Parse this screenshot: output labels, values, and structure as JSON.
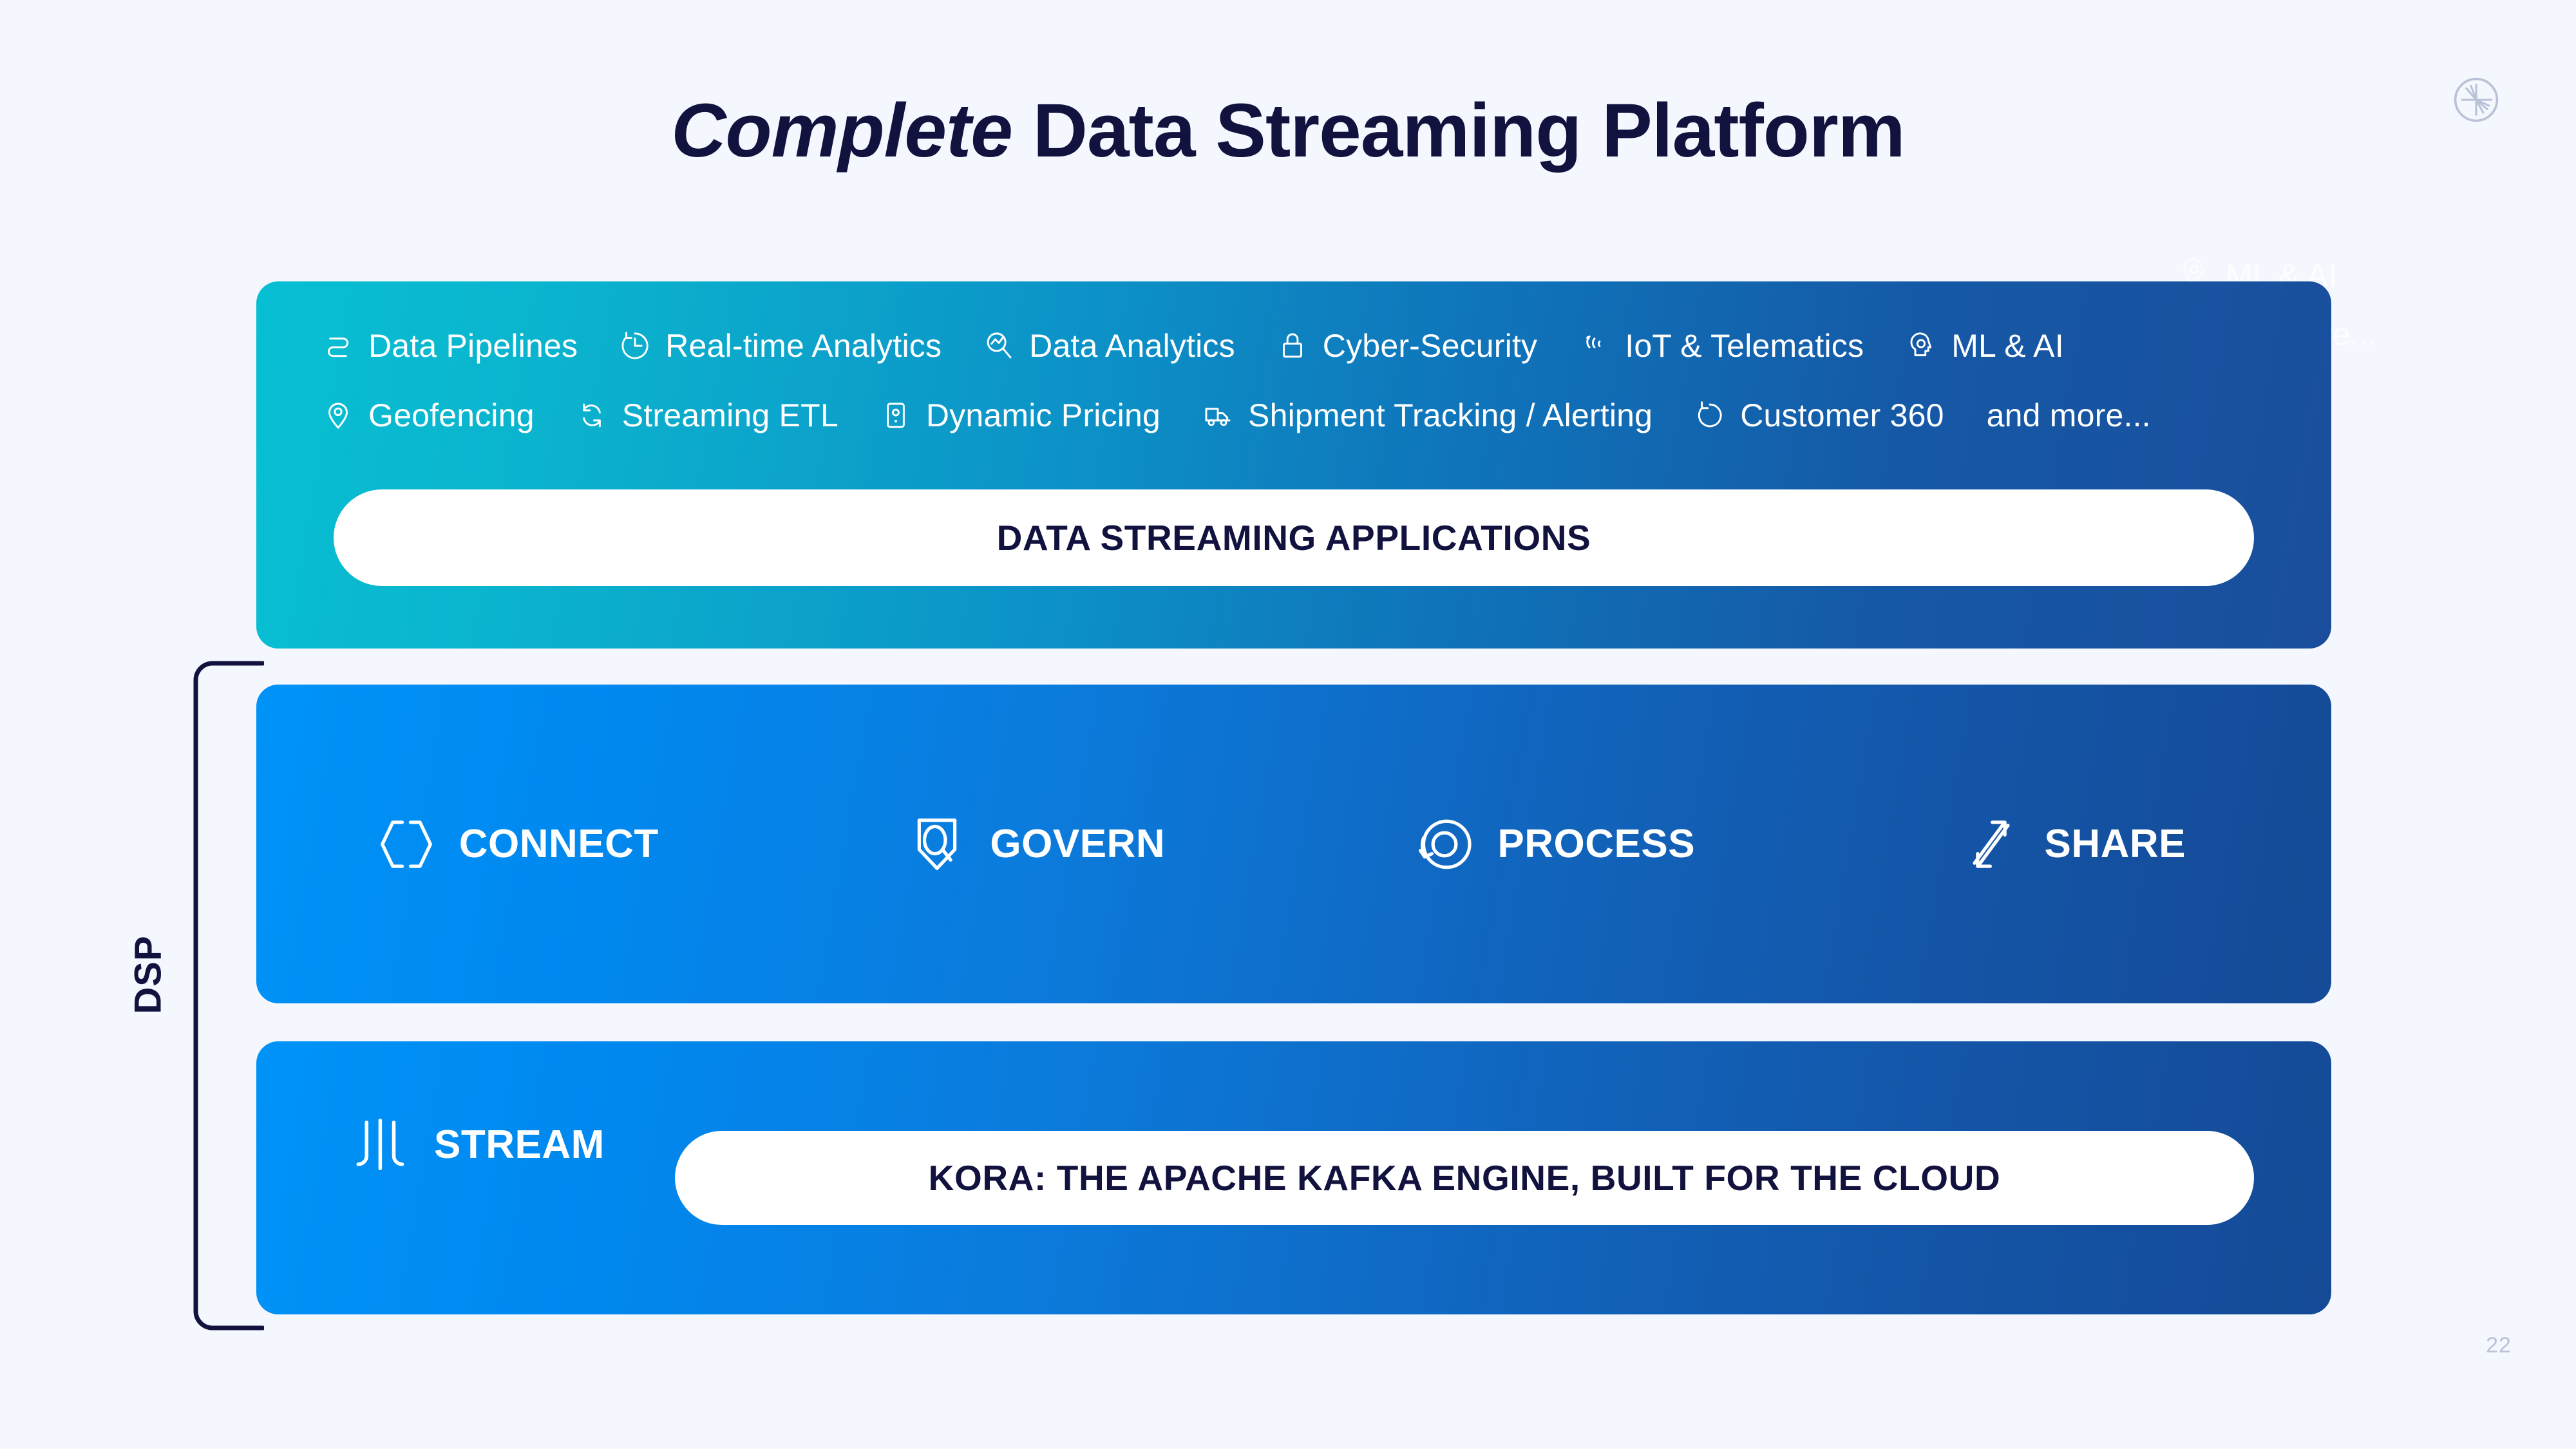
{
  "slide": {
    "title_emphasis": "Complete",
    "title_rest": " Data Streaming Platform",
    "page_number": "22",
    "logo_name": "confluent-logo",
    "dsp_label": "DSP",
    "colors": {
      "background": "#f4f7fd",
      "title_text": "#12123f",
      "apps_panel_start": "#07BFD3",
      "apps_panel_end": "#1A4E9C",
      "dsp_panel_start": "#0093F7",
      "dsp_panel_end": "#144A96",
      "pill_background": "#ffffff",
      "pill_text": "#12123f",
      "page_number_text": "#b9c2d6"
    }
  },
  "apps_panel": {
    "pill_label": "DATA STREAMING APPLICATIONS",
    "use_case_rows": [
      [
        {
          "label": "Data Pipelines",
          "icon": "pipeline-icon"
        },
        {
          "label": "Real-time Analytics",
          "icon": "realtime-analytics-icon"
        },
        {
          "label": "Data Analytics",
          "icon": "data-analytics-icon"
        },
        {
          "label": "Cyber-Security",
          "icon": "lock-icon"
        },
        {
          "label": "IoT & Telematics",
          "icon": "signal-waves-icon"
        },
        {
          "label": "ML & AI",
          "icon": "ai-head-icon"
        }
      ],
      [
        {
          "label": "Geofencing",
          "icon": "map-pin-icon"
        },
        {
          "label": "Streaming ETL",
          "icon": "refresh-cycle-icon"
        },
        {
          "label": "Dynamic Pricing",
          "icon": "mobile-device-icon"
        },
        {
          "label": "Shipment Tracking / Alerting",
          "icon": "truck-icon"
        },
        {
          "label": "Customer 360",
          "icon": "circular-arrow-icon"
        },
        {
          "label": "and more...",
          "icon": "none"
        }
      ]
    ],
    "ghost_overflow": {
      "label": "ML & AI",
      "icon": "ai-head-icon",
      "more_label": "re..."
    }
  },
  "dsp_capabilities_panel": {
    "capabilities": [
      {
        "label": "CONNECT",
        "icon": "hexagon-brackets-icon"
      },
      {
        "label": "GOVERN",
        "icon": "shield-search-icon"
      },
      {
        "label": "PROCESS",
        "icon": "concentric-circles-icon"
      },
      {
        "label": "SHARE",
        "icon": "exchange-arrows-icon"
      }
    ]
  },
  "dsp_stream_panel": {
    "stream_label": "STREAM",
    "stream_icon": "stream-lines-icon",
    "pill_label": "KORA: THE APACHE KAFKA ENGINE, BUILT FOR THE CLOUD"
  }
}
